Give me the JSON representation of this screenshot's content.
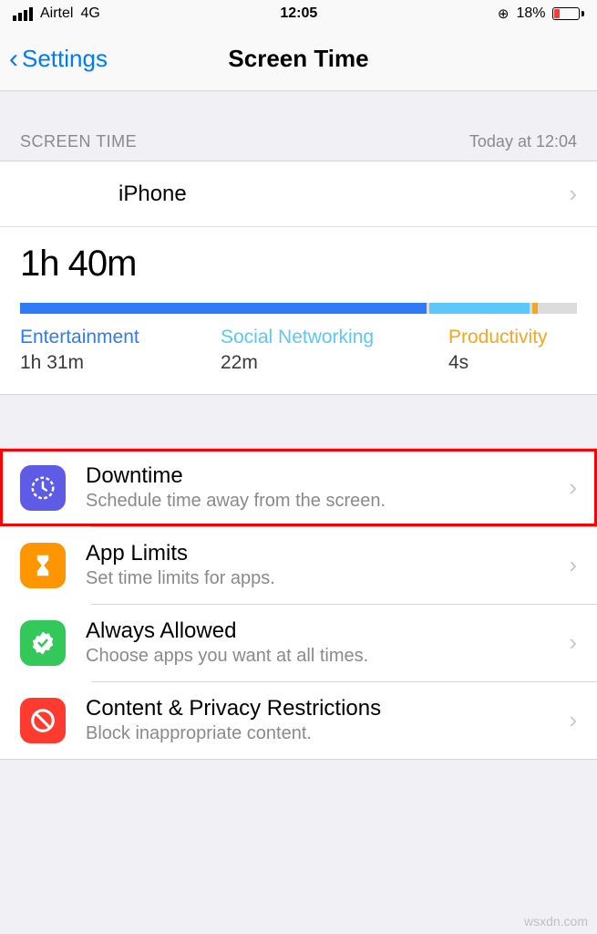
{
  "statusbar": {
    "carrier": "Airtel",
    "network": "4G",
    "time": "12:05",
    "battery_percent": "18%"
  },
  "nav": {
    "back_label": "Settings",
    "title": "Screen Time"
  },
  "section": {
    "header_left": "SCREEN TIME",
    "header_right": "Today at 12:04",
    "device_name": "iPhone"
  },
  "usage": {
    "total": "1h 40m",
    "categories": [
      {
        "name": "Entertainment",
        "time": "1h 31m",
        "color": "c-blue",
        "width": 73
      },
      {
        "name": "Social Networking",
        "time": "22m",
        "color": "c-cyan",
        "width": 18
      },
      {
        "name": "Productivity",
        "time": "4s",
        "color": "c-orange",
        "width": 1
      }
    ]
  },
  "settings": [
    {
      "title": "Downtime",
      "subtitle": "Schedule time away from the screen."
    },
    {
      "title": "App Limits",
      "subtitle": "Set time limits for apps."
    },
    {
      "title": "Always Allowed",
      "subtitle": "Choose apps you want at all times."
    },
    {
      "title": "Content & Privacy Restrictions",
      "subtitle": "Block inappropriate content."
    }
  ],
  "watermark": "wsxdn.com"
}
